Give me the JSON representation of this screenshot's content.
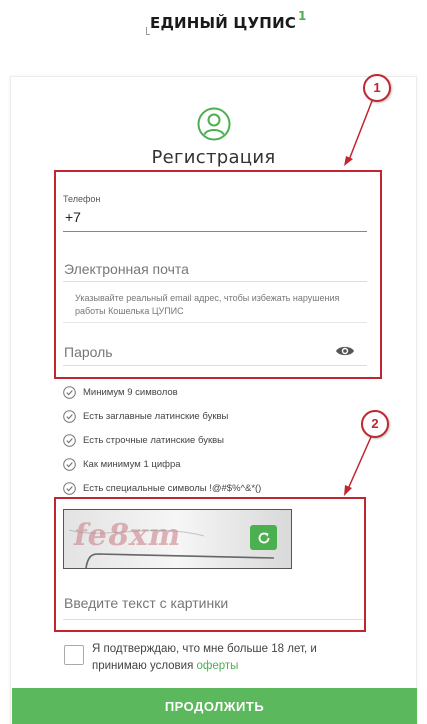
{
  "header": {
    "logo_text": "ЕДИНЫЙ ЦУПИС",
    "logo_superscript": "1"
  },
  "form": {
    "title": "Регистрация",
    "phone": {
      "label": "Телефон",
      "value": "+7"
    },
    "email": {
      "placeholder": "Электронная почта",
      "hint": "Указывайте реальный email адрес, чтобы избежать нарушения работы Кошелька ЦУПИС"
    },
    "password": {
      "placeholder": "Пароль"
    },
    "password_rules": [
      "Минимум 9 символов",
      "Есть заглавные латинские буквы",
      "Есть строчные латинские буквы",
      "Как минимум 1 цифра",
      "Есть специальные символы !@#$%^&*()"
    ],
    "captcha": {
      "image_text": "fe8xm",
      "placeholder": "Введите текст с картинки"
    },
    "agreement": {
      "text": "Я подтверждаю, что мне больше 18 лет, и принимаю условия",
      "link": "оферты"
    },
    "submit_label": "ПРОДОЛЖИТЬ"
  },
  "annotations": {
    "marker_1": "1",
    "marker_2": "2"
  },
  "colors": {
    "accent": "#4caf50",
    "button": "#5cb85c",
    "annotation": "#c0262f"
  },
  "icons": [
    "user-circle-icon",
    "eye-icon",
    "check-circle-icon",
    "refresh-icon"
  ]
}
